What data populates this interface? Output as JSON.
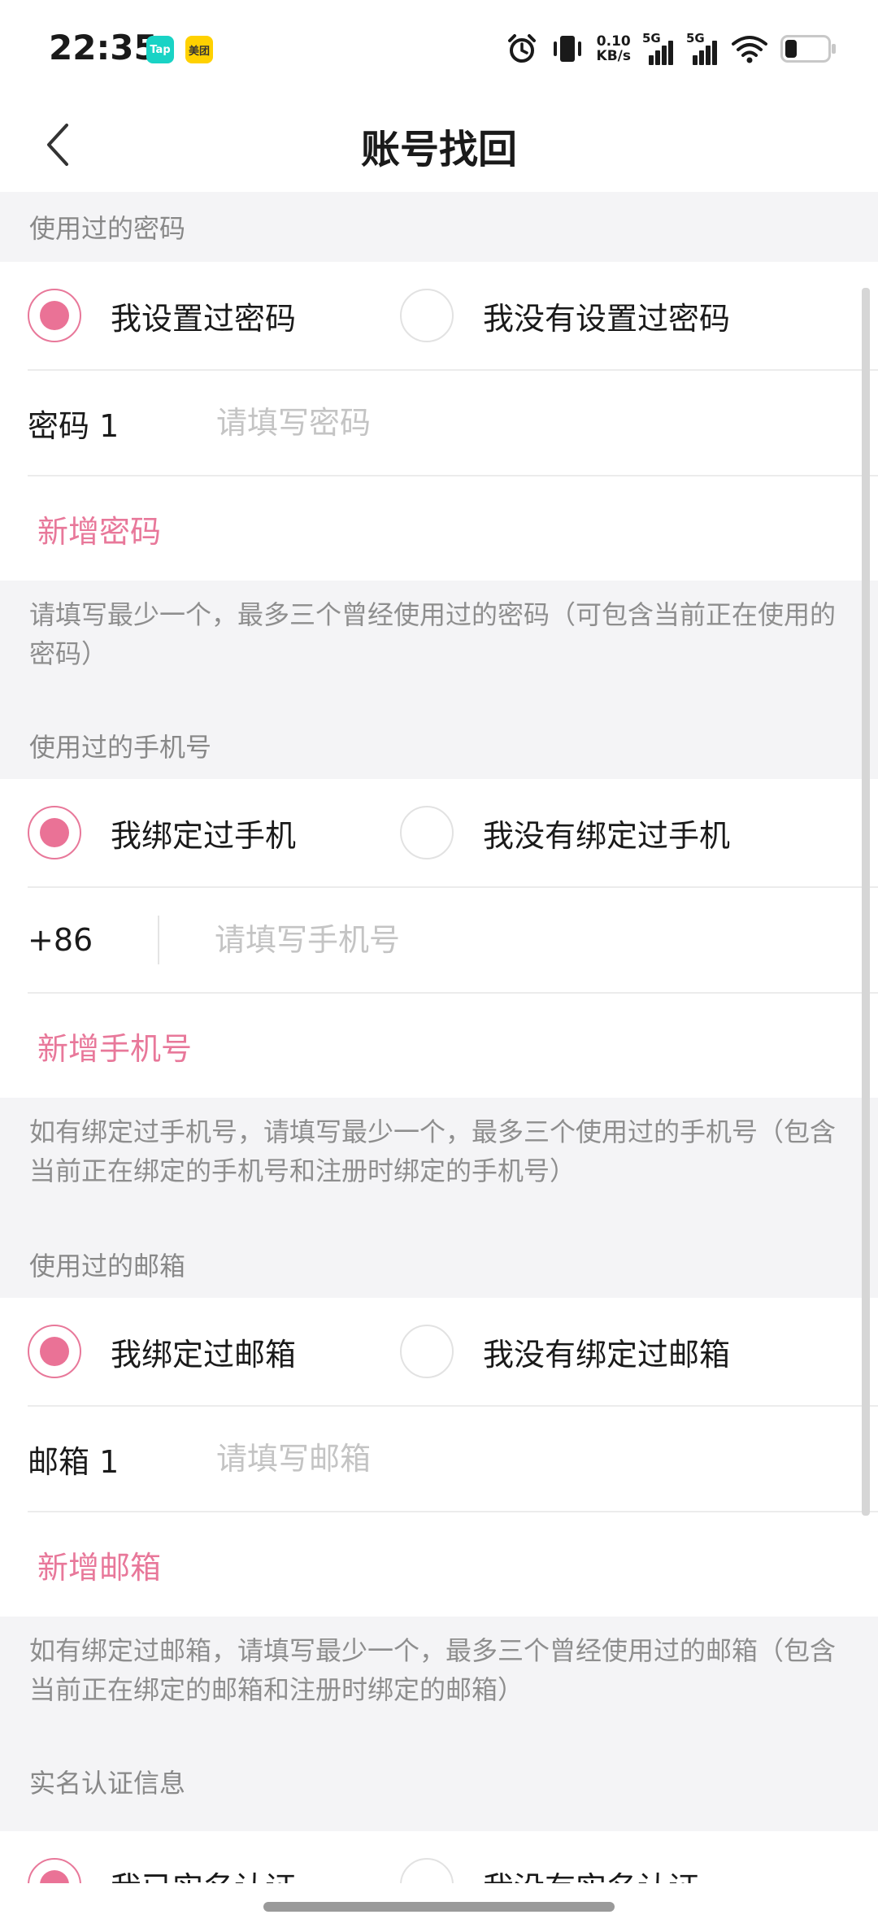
{
  "status_bar": {
    "time": "22:35",
    "badge_tap": "Tap",
    "badge_meituan": "美团",
    "speed_value": "0.10",
    "speed_unit": "KB/s",
    "sim1": "5G",
    "sim2": "5G"
  },
  "header": {
    "title": "账号找回"
  },
  "password_section": {
    "label": "使用过的密码",
    "option_yes": "我设置过密码",
    "option_no": "我没有设置过密码",
    "field_label": "密码 1",
    "placeholder": "请填写密码",
    "add_label": "新增密码",
    "hint": "请填写最少一个，最多三个曾经使用过的密码（可包含当前正在使用的密码）"
  },
  "phone_section": {
    "label": "使用过的手机号",
    "option_yes": "我绑定过手机",
    "option_no": "我没有绑定过手机",
    "prefix": "+86",
    "placeholder": "请填写手机号",
    "add_label": "新增手机号",
    "hint": "如有绑定过手机号，请填写最少一个，最多三个使用过的手机号（包含当前正在绑定的手机号和注册时绑定的手机号）"
  },
  "email_section": {
    "label": "使用过的邮箱",
    "option_yes": "我绑定过邮箱",
    "option_no": "我没有绑定过邮箱",
    "field_label": "邮箱 1",
    "placeholder": "请填写邮箱",
    "add_label": "新增邮箱",
    "hint": "如有绑定过邮箱，请填写最少一个，最多三个曾经使用过的邮箱（包含当前正在绑定的邮箱和注册时绑定的邮箱）"
  },
  "realname_section": {
    "label": "实名认证信息",
    "option_yes": "我已实名认证",
    "option_no": "我没有实名认证"
  },
  "colors": {
    "accent": "#ea7296",
    "background_gray": "#f4f4f6"
  }
}
